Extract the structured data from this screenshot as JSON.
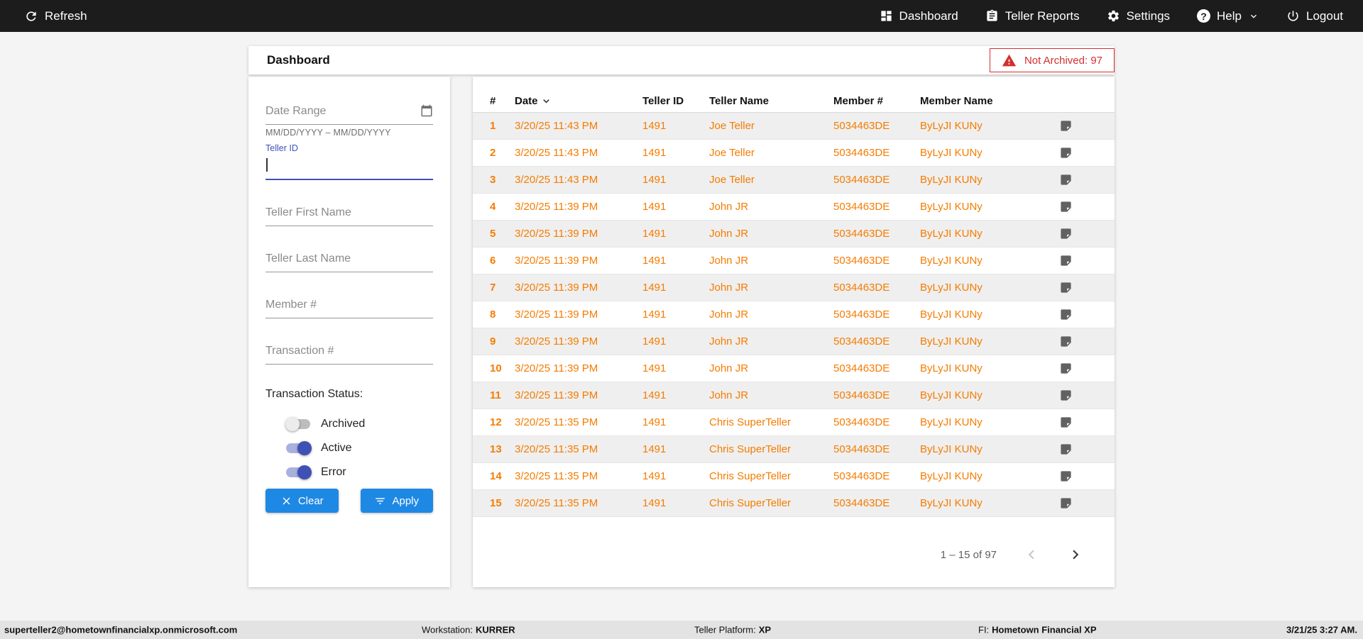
{
  "navbar": {
    "refresh_label": "Refresh",
    "dashboard_label": "Dashboard",
    "teller_reports_label": "Teller Reports",
    "settings_label": "Settings",
    "help_label": "Help",
    "logout_label": "Logout"
  },
  "header": {
    "title": "Dashboard",
    "not_archived_badge": "Not Archived: 97"
  },
  "filters": {
    "date_range_placeholder": "Date Range",
    "date_range_helper": "MM/DD/YYYY – MM/DD/YYYY",
    "teller_id_label": "Teller ID",
    "teller_first_name_placeholder": "Teller First Name",
    "teller_last_name_placeholder": "Teller Last Name",
    "member_number_placeholder": "Member #",
    "transaction_number_placeholder": "Transaction #",
    "transaction_status_label": "Transaction Status:",
    "toggles": [
      {
        "label": "Archived",
        "on": false
      },
      {
        "label": "Active",
        "on": true
      },
      {
        "label": "Error",
        "on": true
      }
    ],
    "clear_button_label": "Clear",
    "apply_button_label": "Apply"
  },
  "table": {
    "columns": {
      "num": "#",
      "date": "Date",
      "teller_id": "Teller ID",
      "teller_name": "Teller Name",
      "member_number": "Member #",
      "member_name": "Member Name"
    },
    "rows": [
      {
        "num": "1",
        "date": "3/20/25 11:43 PM",
        "teller_id": "1491",
        "teller_name": "Joe Teller",
        "member_number": "5034463DE",
        "member_name": "ByLyJI KUNy"
      },
      {
        "num": "2",
        "date": "3/20/25 11:43 PM",
        "teller_id": "1491",
        "teller_name": "Joe Teller",
        "member_number": "5034463DE",
        "member_name": "ByLyJI KUNy"
      },
      {
        "num": "3",
        "date": "3/20/25 11:43 PM",
        "teller_id": "1491",
        "teller_name": "Joe Teller",
        "member_number": "5034463DE",
        "member_name": "ByLyJI KUNy"
      },
      {
        "num": "4",
        "date": "3/20/25 11:39 PM",
        "teller_id": "1491",
        "teller_name": "John JR",
        "member_number": "5034463DE",
        "member_name": "ByLyJI KUNy"
      },
      {
        "num": "5",
        "date": "3/20/25 11:39 PM",
        "teller_id": "1491",
        "teller_name": "John JR",
        "member_number": "5034463DE",
        "member_name": "ByLyJI KUNy"
      },
      {
        "num": "6",
        "date": "3/20/25 11:39 PM",
        "teller_id": "1491",
        "teller_name": "John JR",
        "member_number": "5034463DE",
        "member_name": "ByLyJI KUNy"
      },
      {
        "num": "7",
        "date": "3/20/25 11:39 PM",
        "teller_id": "1491",
        "teller_name": "John JR",
        "member_number": "5034463DE",
        "member_name": "ByLyJI KUNy"
      },
      {
        "num": "8",
        "date": "3/20/25 11:39 PM",
        "teller_id": "1491",
        "teller_name": "John JR",
        "member_number": "5034463DE",
        "member_name": "ByLyJI KUNy"
      },
      {
        "num": "9",
        "date": "3/20/25 11:39 PM",
        "teller_id": "1491",
        "teller_name": "John JR",
        "member_number": "5034463DE",
        "member_name": "ByLyJI KUNy"
      },
      {
        "num": "10",
        "date": "3/20/25 11:39 PM",
        "teller_id": "1491",
        "teller_name": "John JR",
        "member_number": "5034463DE",
        "member_name": "ByLyJI KUNy"
      },
      {
        "num": "11",
        "date": "3/20/25 11:39 PM",
        "teller_id": "1491",
        "teller_name": "John JR",
        "member_number": "5034463DE",
        "member_name": "ByLyJI KUNy"
      },
      {
        "num": "12",
        "date": "3/20/25 11:35 PM",
        "teller_id": "1491",
        "teller_name": "Chris SuperTeller",
        "member_number": "5034463DE",
        "member_name": "ByLyJI KUNy"
      },
      {
        "num": "13",
        "date": "3/20/25 11:35 PM",
        "teller_id": "1491",
        "teller_name": "Chris SuperTeller",
        "member_number": "5034463DE",
        "member_name": "ByLyJI KUNy"
      },
      {
        "num": "14",
        "date": "3/20/25 11:35 PM",
        "teller_id": "1491",
        "teller_name": "Chris SuperTeller",
        "member_number": "5034463DE",
        "member_name": "ByLyJI KUNy"
      },
      {
        "num": "15",
        "date": "3/20/25 11:35 PM",
        "teller_id": "1491",
        "teller_name": "Chris SuperTeller",
        "member_number": "5034463DE",
        "member_name": "ByLyJI KUNy"
      }
    ],
    "pagination_label": "1 – 15 of 97"
  },
  "statusbar": {
    "user_email": "superteller2@hometownfinancialxp.onmicrosoft.com",
    "workstation_label": "Workstation:",
    "workstation_value": "KURRER",
    "teller_platform_label": "Teller Platform:",
    "teller_platform_value": "XP",
    "fi_label": "FI:",
    "fi_value": "Hometown Financial XP",
    "datetime": "3/21/25 3:27 AM."
  },
  "icons": {
    "refresh": "circular-arrow",
    "dashboard": "grid-squares",
    "teller_reports": "clipboard",
    "settings": "gear",
    "help": "question-circle",
    "help_chevron": "chevron-down",
    "logout": "power",
    "date_range": "calendar",
    "not_archived": "warning-triangle",
    "clear": "x-mark",
    "apply": "filter-lines",
    "date_sort": "chevron-down",
    "row_note": "note",
    "page_prev": "chevron-left",
    "page_next": "chevron-right"
  },
  "colors": {
    "accent_orange": "#F57C00",
    "button_blue": "#1E88E5",
    "focus_blue": "#3F51B5",
    "error_red": "#D32F2F",
    "navbar_black": "#1C1C1C"
  }
}
